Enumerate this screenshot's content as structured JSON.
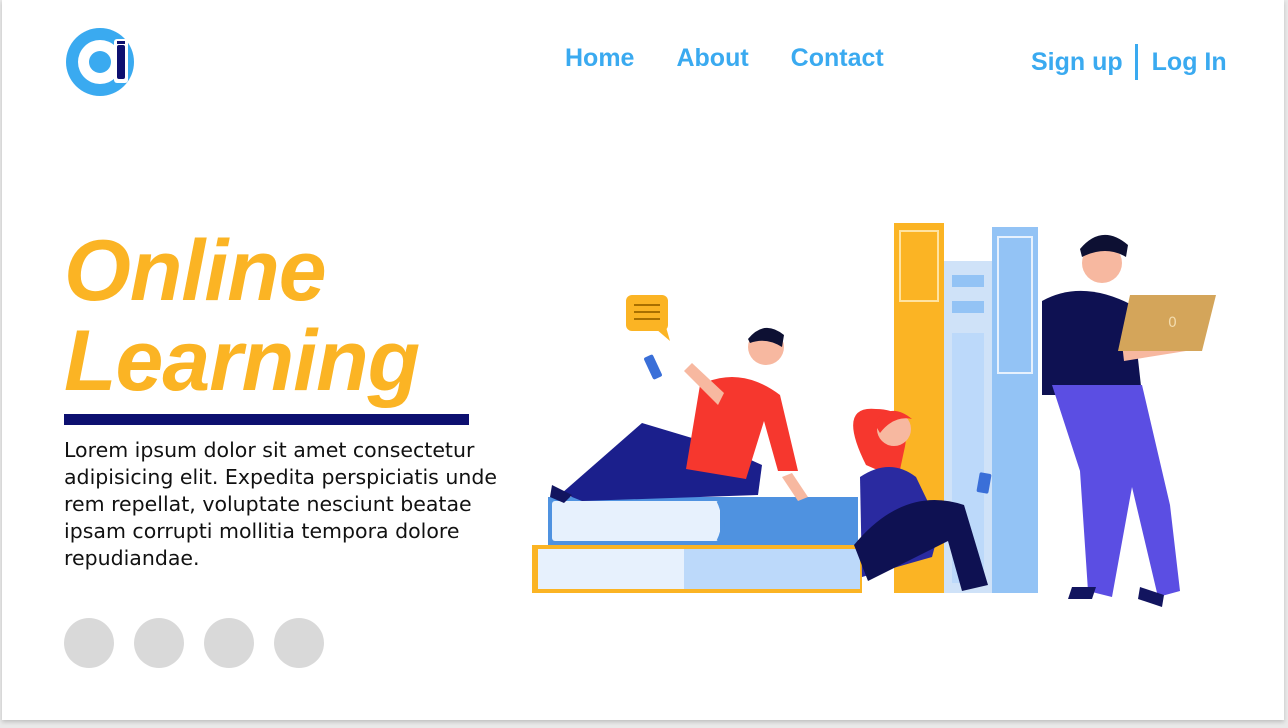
{
  "header": {
    "logo_icon": "online-learning-logo-icon",
    "nav": [
      {
        "label": "Home"
      },
      {
        "label": "About"
      },
      {
        "label": "Contact"
      }
    ],
    "auth": {
      "signup_label": "Sign up",
      "login_label": "Log In"
    }
  },
  "hero": {
    "title_line1": "Online",
    "title_line2": "Learning",
    "description": "Lorem ipsum dolor sit amet consectetur adipisicing elit. Expedita perspiciatis unde rem repellat, voluptate nesciunt beatae ipsam corrupti mollitia tempora dolore repudiandae.",
    "carousel_dots": 4,
    "laptop_mark": "0"
  },
  "colors": {
    "accent_blue": "#3aaaf0",
    "title_yellow": "#fbb424",
    "underline_navy": "#0d1070",
    "dot_gray": "#d9d9d9"
  }
}
